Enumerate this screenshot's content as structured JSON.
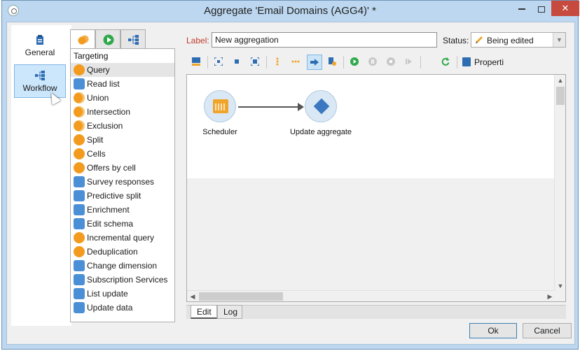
{
  "window": {
    "title": "Aggregate 'Email Domains (AGG4)' *",
    "controls": {
      "minimize": "",
      "maximize": "",
      "close": "✕"
    }
  },
  "nav": {
    "items": [
      {
        "label": "General",
        "icon": "clipboard-icon"
      },
      {
        "label": "Workflow",
        "icon": "workflow-icon",
        "selected": true
      }
    ]
  },
  "activity_tabs": [
    {
      "icon": "targeting-icon",
      "active": true
    },
    {
      "icon": "flow-control-icon",
      "active": false
    },
    {
      "icon": "actions-icon",
      "active": false
    }
  ],
  "activities": {
    "header": "Targeting",
    "items": [
      {
        "label": "Query",
        "icon": "query-icon",
        "selected": true
      },
      {
        "label": "Read list",
        "icon": "read-list-icon"
      },
      {
        "label": "Union",
        "icon": "union-icon"
      },
      {
        "label": "Intersection",
        "icon": "intersection-icon"
      },
      {
        "label": "Exclusion",
        "icon": "exclusion-icon"
      },
      {
        "label": "Split",
        "icon": "split-icon"
      },
      {
        "label": "Cells",
        "icon": "cells-icon"
      },
      {
        "label": "Offers by cell",
        "icon": "offers-by-cell-icon"
      },
      {
        "label": "Survey responses",
        "icon": "survey-responses-icon"
      },
      {
        "label": "Predictive split",
        "icon": "predictive-split-icon"
      },
      {
        "label": "Enrichment",
        "icon": "enrichment-icon"
      },
      {
        "label": "Edit schema",
        "icon": "edit-schema-icon"
      },
      {
        "label": "Incremental query",
        "icon": "incremental-query-icon"
      },
      {
        "label": "Deduplication",
        "icon": "deduplication-icon"
      },
      {
        "label": "Change dimension",
        "icon": "change-dimension-icon"
      },
      {
        "label": "Subscription Services",
        "icon": "subscription-services-icon"
      },
      {
        "label": "List update",
        "icon": "list-update-icon"
      },
      {
        "label": "Update data",
        "icon": "update-data-icon"
      }
    ]
  },
  "editor": {
    "label_caption": "Label:",
    "label_value": "New aggregation",
    "status_caption": "Status:",
    "status_value": "Being edited",
    "properties_label": "Properti"
  },
  "workflow": {
    "nodes": [
      {
        "label": "Scheduler",
        "icon": "scheduler-icon"
      },
      {
        "label": "Update aggregate",
        "icon": "update-aggregate-icon"
      }
    ]
  },
  "bottom_tabs": [
    {
      "label": "Edit",
      "active": true
    },
    {
      "label": "Log",
      "active": false
    }
  ],
  "buttons": {
    "ok": "Ok",
    "cancel": "Cancel"
  },
  "colors": {
    "title_bar": "#bcd7ef",
    "close_button": "#c74a3f",
    "accent_orange": "#f29b1f",
    "accent_blue": "#3c78c0",
    "label_red": "#c0392b"
  }
}
